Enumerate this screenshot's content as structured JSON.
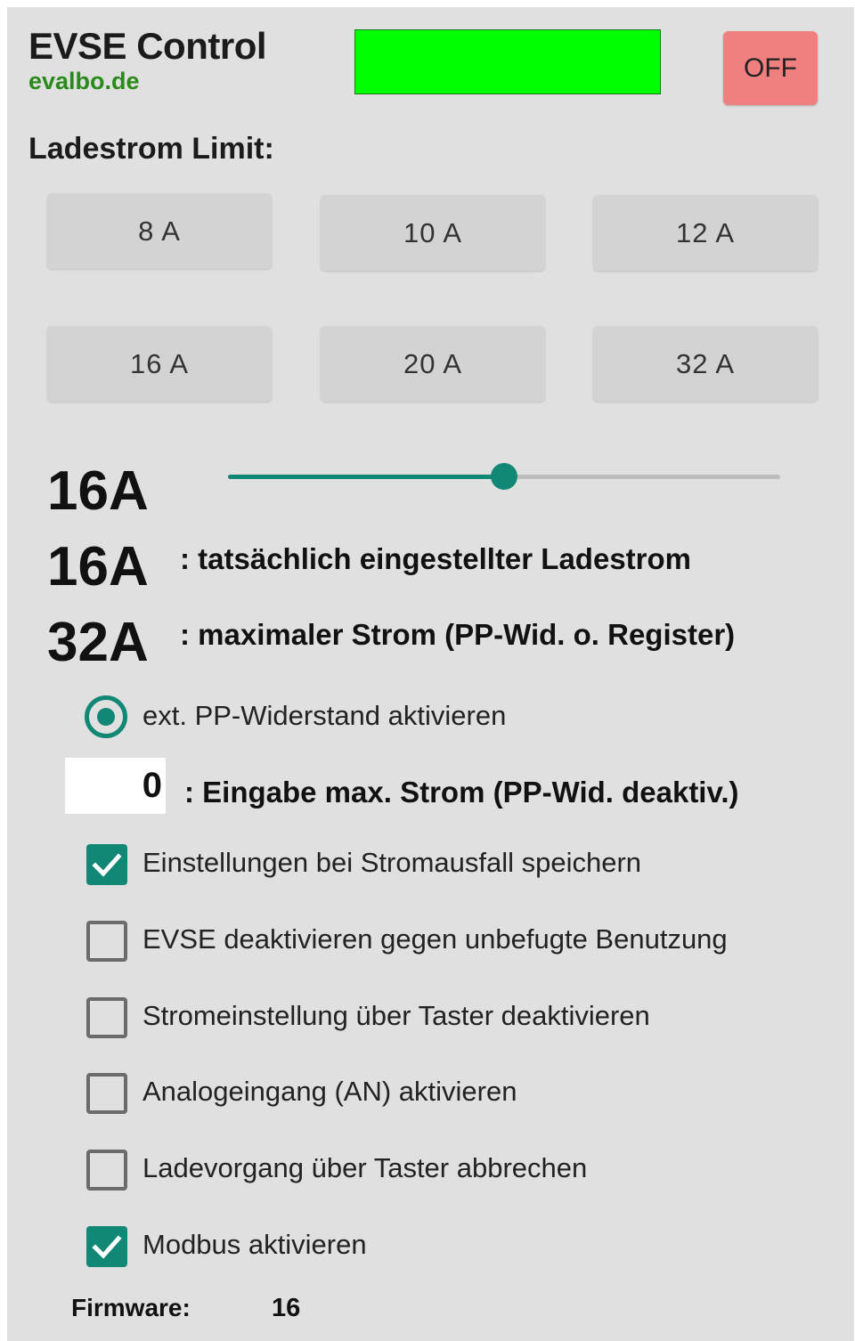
{
  "header": {
    "title": "EVSE Control",
    "subtitle": "evalbo.de",
    "status_color": "#00ff00",
    "off_label": "OFF"
  },
  "current_limit": {
    "label": "Ladestrom Limit:",
    "presets": [
      "8 A",
      "10 A",
      "12 A",
      "16 A",
      "20 A",
      "32 A"
    ]
  },
  "slider": {
    "value_label": "16A",
    "level_fraction": 0.5,
    "accent": "#118775"
  },
  "readouts": {
    "actual_value": "16A",
    "actual_desc": ": tatsächlich eingestellter Ladestrom",
    "max_value": "32A",
    "max_desc": ": maximaler Strom (PP-Wid. o. Register)"
  },
  "pp_resistor": {
    "label": "ext. PP-Widerstand aktivieren",
    "selected": true
  },
  "max_input": {
    "value": "0",
    "desc": ": Eingabe max. Strom (PP-Wid. deaktiv.)"
  },
  "options": [
    {
      "label": "Einstellungen bei Stromausfall speichern",
      "checked": true
    },
    {
      "label": "EVSE deaktivieren gegen unbefugte Benutzung",
      "checked": false
    },
    {
      "label": "Stromeinstellung über Taster deaktivieren",
      "checked": false
    },
    {
      "label": "Analogeingang (AN) aktivieren",
      "checked": false
    },
    {
      "label": "Ladevorgang über Taster abbrechen",
      "checked": false
    },
    {
      "label": "Modbus aktivieren",
      "checked": true
    }
  ],
  "firmware": {
    "label": "Firmware:",
    "value": "16"
  }
}
